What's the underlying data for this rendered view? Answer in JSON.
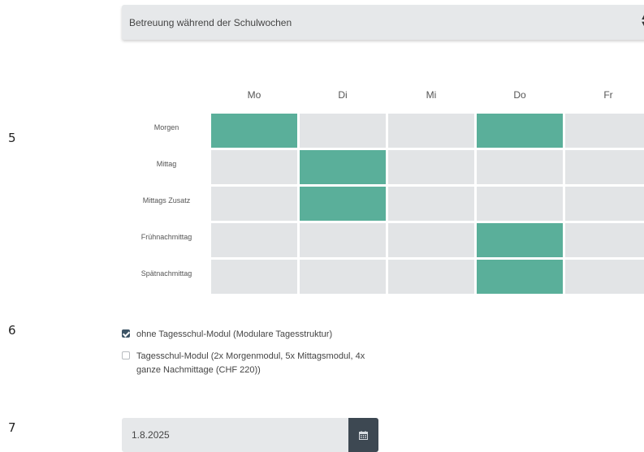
{
  "steps": [
    "5",
    "6",
    "7"
  ],
  "care_select": {
    "value": "Betreuung während der Schulwochen"
  },
  "schedule": {
    "days": [
      "Mo",
      "Di",
      "Mi",
      "Do",
      "Fr"
    ],
    "rows": [
      {
        "label": "Morgen",
        "selected": [
          true,
          false,
          false,
          true,
          false
        ]
      },
      {
        "label": "Mittag",
        "selected": [
          false,
          true,
          false,
          false,
          false
        ]
      },
      {
        "label": "Mittags Zusatz",
        "selected": [
          false,
          true,
          false,
          false,
          false
        ]
      },
      {
        "label": "Frühnachmittag",
        "selected": [
          false,
          false,
          false,
          true,
          false
        ]
      },
      {
        "label": "Spätnachmittag",
        "selected": [
          false,
          false,
          false,
          true,
          false
        ]
      }
    ],
    "selected_color": "#5aaf9a",
    "unselected_color": "#e2e4e6"
  },
  "options": [
    {
      "label": "ohne Tagesschul-Modul (Modulare Tagesstruktur)",
      "checked": true
    },
    {
      "label": "Tagesschul-Modul (2x Morgenmodul, 5x Mittagsmodul, 4x ganze Nachmittage (CHF 220))",
      "checked": false
    }
  ],
  "start_date": {
    "value": "1.8.2025",
    "icon": "calendar-icon"
  }
}
